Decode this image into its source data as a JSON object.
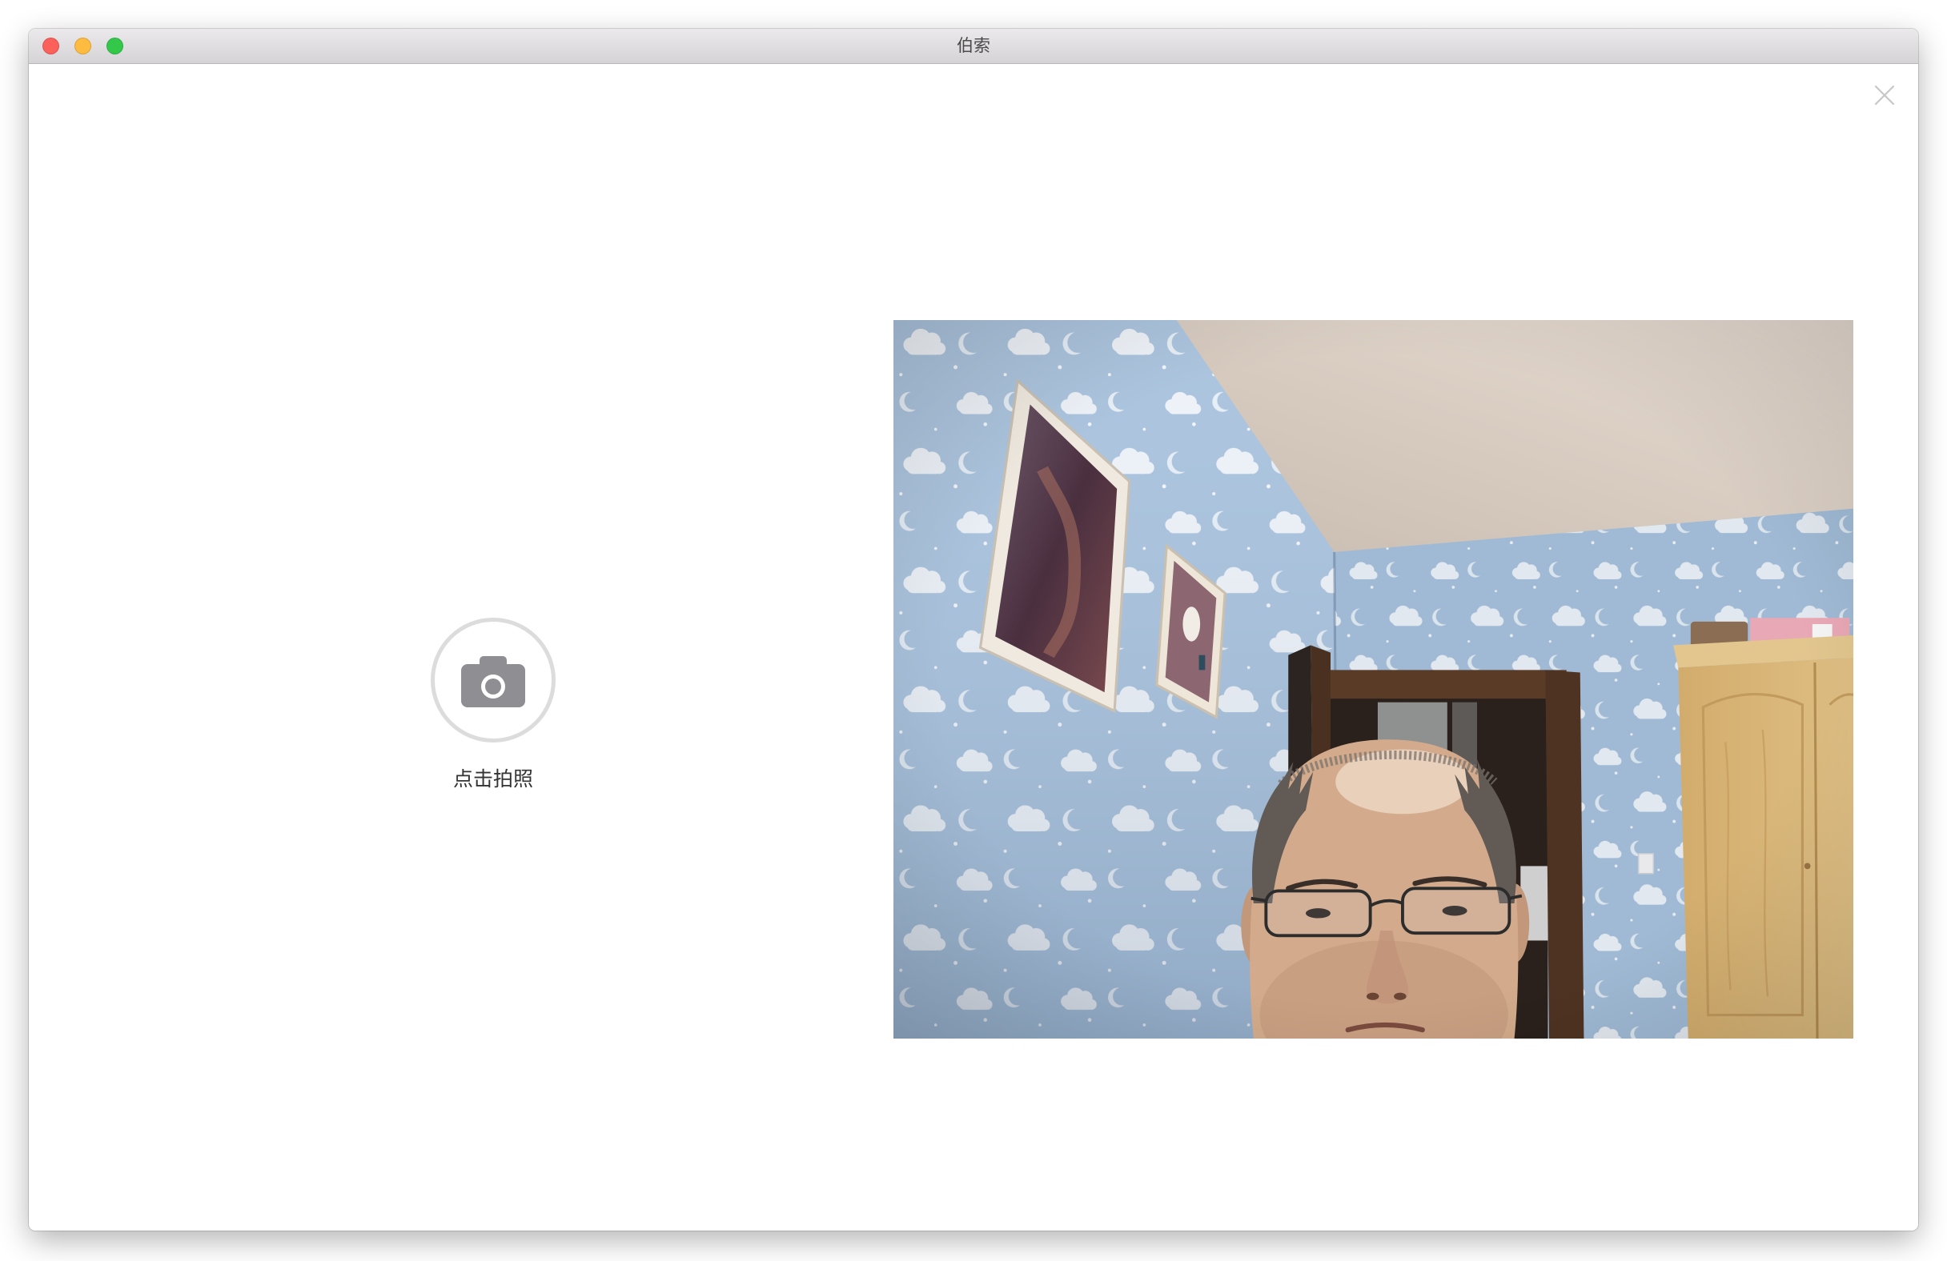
{
  "window": {
    "title": "伯索",
    "controls": [
      {
        "icon": "close-window-icon",
        "color": "#fc605b"
      },
      {
        "icon": "minimize-window-icon",
        "color": "#fdbc40"
      },
      {
        "icon": "zoom-window-icon",
        "color": "#34c84a"
      }
    ]
  },
  "dialog": {
    "close_icon": "close-icon",
    "close_color": "#c7c7c7"
  },
  "capture": {
    "label": "点击拍照",
    "icon": "camera-icon",
    "icon_color": "#8e8e93",
    "ring_color": "#dcdcdc"
  }
}
